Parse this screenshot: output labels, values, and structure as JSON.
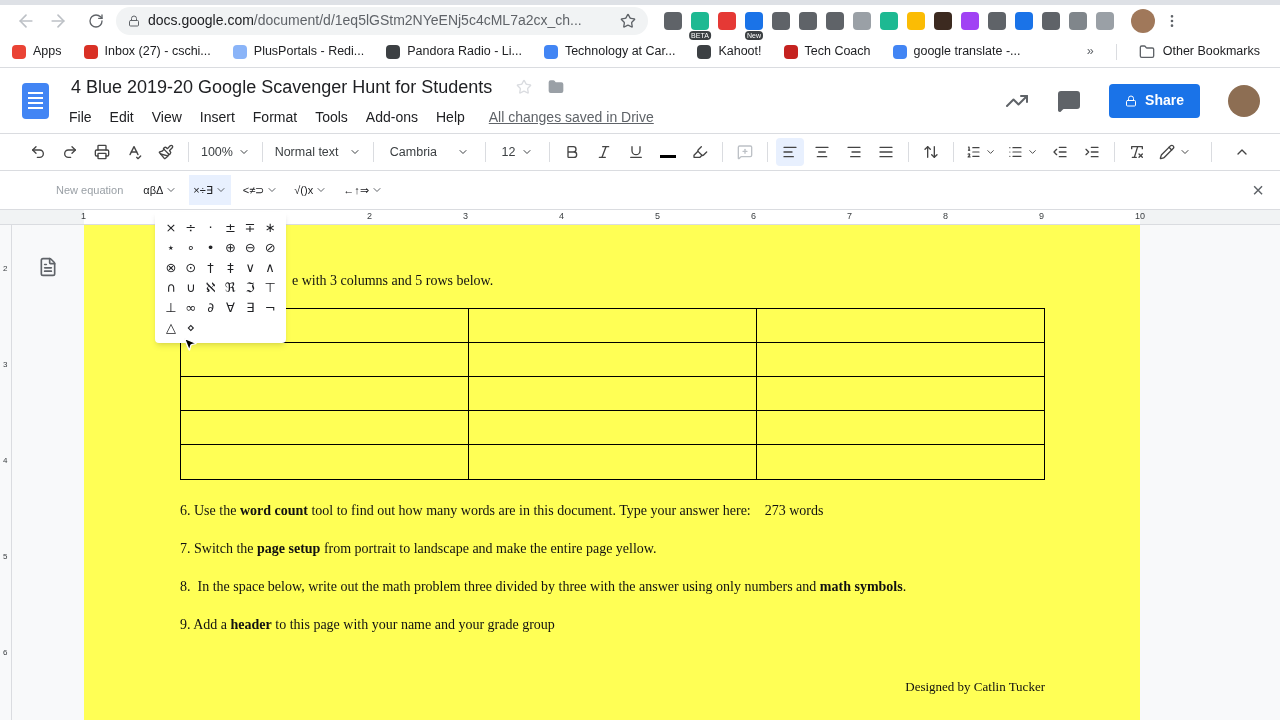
{
  "browser": {
    "url_host": "docs.google.com",
    "url_path": "/document/d/1eq5lGStm2NYeENj5c4cML7a2cx_ch...",
    "extensions": [
      {
        "color": "#5f6368"
      },
      {
        "color": "#1db992",
        "badge": "BETA"
      },
      {
        "color": "#e53935"
      },
      {
        "color": "#1a73e8",
        "badge": "New"
      },
      {
        "color": "#5f6368"
      },
      {
        "color": "#5f6368"
      },
      {
        "color": "#5f6368"
      },
      {
        "color": "#9aa0a6"
      },
      {
        "color": "#1db992"
      },
      {
        "color": "#fbbc04"
      },
      {
        "color": "#3c2a20"
      },
      {
        "color": "#a142f4"
      },
      {
        "color": "#5f6368"
      },
      {
        "color": "#1a73e8"
      },
      {
        "color": "#5f6368"
      },
      {
        "color": "#80868b"
      },
      {
        "color": "#9aa0a6"
      }
    ],
    "bookmarks": [
      {
        "label": "Apps",
        "color": "#ea4335"
      },
      {
        "label": "Inbox (27) - cschi...",
        "color": "#d93025"
      },
      {
        "label": "PlusPortals - Redi...",
        "color": "#8ab4f8"
      },
      {
        "label": "Pandora Radio - Li...",
        "color": "#3c4043"
      },
      {
        "label": "Technology at Car...",
        "color": "#4285f4"
      },
      {
        "label": "Kahoot!",
        "color": "#3c4043"
      },
      {
        "label": "Tech Coach",
        "color": "#c5221f"
      },
      {
        "label": "google translate -...",
        "color": "#4285f4"
      }
    ],
    "more_bookmarks": "»",
    "other_bookmarks": "Other Bookmarks"
  },
  "document": {
    "title": "4 Blue 2019-20 Google Scavenger Hunt for Students",
    "starred": false,
    "save_status": "All changes saved in Drive",
    "menu": [
      "File",
      "Edit",
      "View",
      "Insert",
      "Format",
      "Tools",
      "Add-ons",
      "Help"
    ],
    "share": "Share"
  },
  "toolbar": {
    "zoom": "100%",
    "style": "Normal text",
    "font": "Cambria",
    "size": "12",
    "alignments": [
      {
        "selected": true
      },
      {
        "selected": false
      },
      {
        "selected": false
      },
      {
        "selected": false
      }
    ]
  },
  "equation_bar": {
    "label": "New equation",
    "menus": [
      {
        "label": "αβΔ",
        "selected": false
      },
      {
        "label": "×÷∃",
        "selected": true
      },
      {
        "label": "<≠⊃",
        "selected": false
      },
      {
        "label": "√()x",
        "selected": false
      },
      {
        "label": "←↑⇒",
        "selected": false
      }
    ],
    "close": "×"
  },
  "ruler": {
    "numbers": [
      "1",
      "2",
      "3",
      "4",
      "5",
      "6",
      "7",
      "8",
      "9",
      "10"
    ],
    "vertical_numbers": [
      "2",
      "3",
      "4",
      "5",
      "6"
    ]
  },
  "symbol_menu": [
    [
      "×",
      "÷",
      "·",
      "±",
      "∓",
      "∗"
    ],
    [
      "⋆",
      "∘",
      "•",
      "⊕",
      "⊖",
      "⊘"
    ],
    [
      "⊗",
      "⊙",
      "†",
      "‡",
      "∨",
      "∧"
    ],
    [
      "∩",
      "∪",
      "ℵ",
      "ℜ",
      "ℑ",
      "⊤"
    ],
    [
      "⊥",
      "∞",
      "∂",
      "∀",
      "∃",
      "¬"
    ],
    [
      "△",
      "⋄"
    ]
  ],
  "page": {
    "partial_line": "e with 3 columns and 5 rows below.",
    "paragraphs": [
      {
        "text": "6. Use the **word count** tool to find out how many words are in this document. Type your answer here:    273 words"
      },
      {
        "text": "7. Switch the **page setup** from portrait to landscape and make the entire page yellow."
      },
      {
        "text": "8.  In the space below, write out the math problem three divided by three with the answer using only numbers and **math symbols**."
      },
      {
        "text": "9. Add a **header** to this page with your name and your grade group"
      }
    ],
    "footer": "Designed by Catlin Tucker"
  }
}
